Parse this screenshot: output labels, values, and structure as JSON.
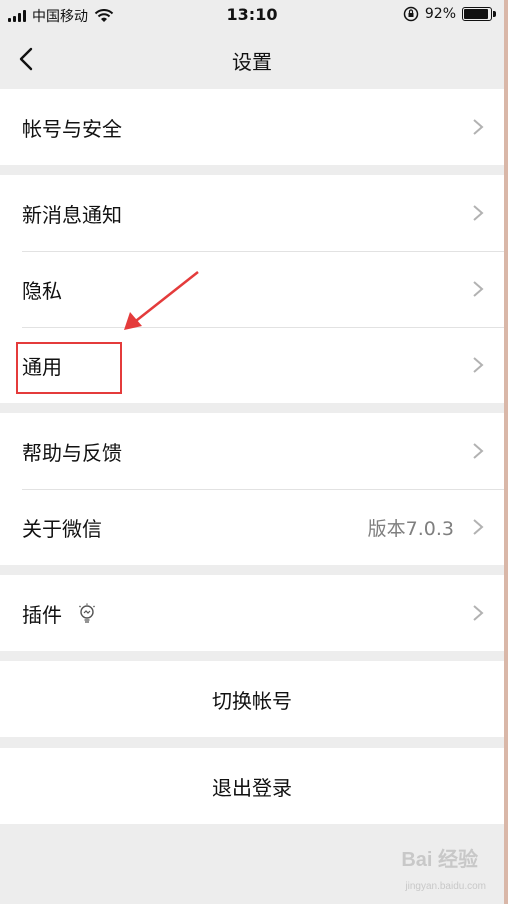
{
  "status_bar": {
    "carrier": "中国移动",
    "time": "13:10",
    "battery": "92%",
    "battery_level": 0.92
  },
  "nav": {
    "title": "设置"
  },
  "groups": [
    {
      "rows": [
        {
          "label": "帐号与安全"
        }
      ]
    },
    {
      "rows": [
        {
          "label": "新消息通知"
        },
        {
          "label": "隐私"
        },
        {
          "label": "通用"
        }
      ]
    },
    {
      "rows": [
        {
          "label": "帮助与反馈"
        },
        {
          "label": "关于微信",
          "value": "版本7.0.3"
        }
      ]
    },
    {
      "rows": [
        {
          "label": "插件"
        }
      ]
    }
  ],
  "actions": {
    "switch_account": "切换帐号",
    "logout": "退出登录"
  },
  "annotation": {
    "highlight_color": "#e43b3b",
    "highlighted_item": "通用"
  },
  "watermark": {
    "text": "Bai 经验",
    "sub": "jingyan.baidu.com"
  }
}
